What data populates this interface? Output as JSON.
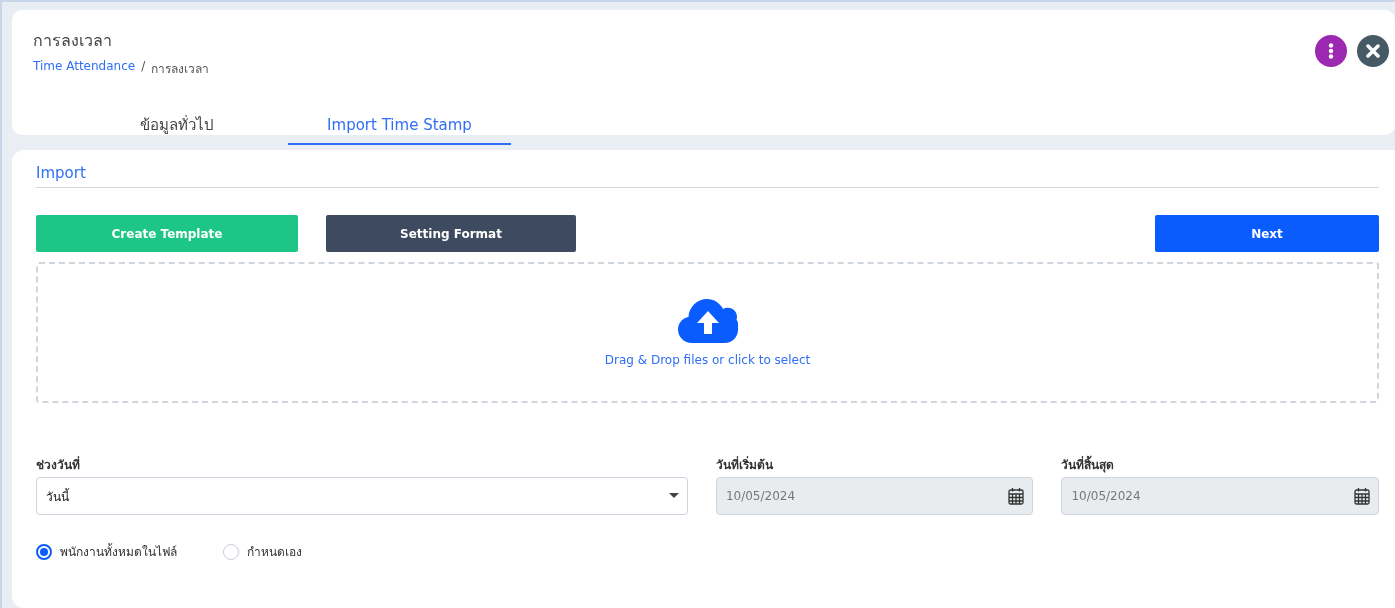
{
  "page": {
    "title": "การลงเวลา"
  },
  "breadcrumb": [
    {
      "label": "Time Attendance",
      "kind": "link"
    },
    {
      "label": "/",
      "kind": "separator"
    },
    {
      "label": "การลงเวลา",
      "kind": "current"
    }
  ],
  "header_actions": [
    {
      "kind": "more"
    },
    {
      "kind": "close"
    }
  ],
  "tabs": [
    {
      "label": "ข้อมูลทั่วไป",
      "selected": false
    },
    {
      "label": "Import Time Stamp",
      "selected": true
    }
  ],
  "section": {
    "title": "Import"
  },
  "buttons": [
    {
      "label": "Create Template",
      "kind": "success"
    },
    {
      "label": "Setting Format",
      "kind": "dark"
    },
    {
      "label": "Next",
      "kind": "primary"
    }
  ],
  "dropzone": {
    "text": "Drag & Drop files or click to select"
  },
  "fields": [
    {
      "label": "ช่วงวันที่",
      "kind": "select",
      "value": "วันนี้",
      "disabled": false
    },
    {
      "label": "วันที่เริ่มต้น",
      "kind": "date",
      "value": "10/05/2024",
      "disabled": true
    },
    {
      "label": "วันที่สิ้นสุด",
      "kind": "date",
      "value": "10/05/2024",
      "disabled": true
    }
  ],
  "radios": [
    {
      "label": "พนักงานทั้งหมดในไฟล์",
      "selected": true
    },
    {
      "label": "กำหนดเอง",
      "selected": false
    }
  ]
}
